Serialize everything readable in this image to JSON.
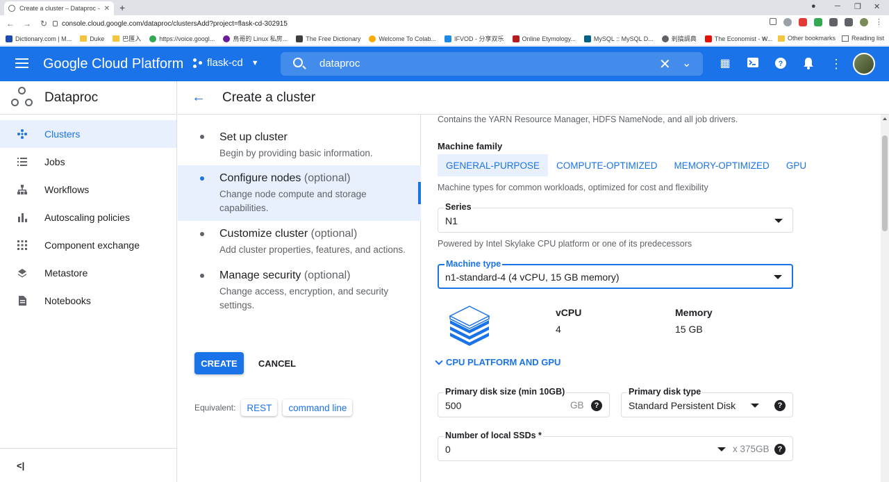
{
  "browser": {
    "tab_title": "Create a cluster – Dataproc – flas",
    "tab_close": "✕",
    "new_tab": "+",
    "url": "console.cloud.google.com/dataproc/clustersAdd?project=flask-cd-302915",
    "bookmarks": [
      "Dictionary.com | M...",
      "Duke",
      "巴匯入",
      "https://voice.googl...",
      "鳥哥的 Linux 私房...",
      "The Free Dictionary",
      "Welcome To Colab...",
      "IFVOD - 分享双乐",
      "Online Etymology...",
      "MySQL :: MySQL D...",
      "剎搞調典",
      "The Economist - W..."
    ],
    "more_bookmarks": "»",
    "other_bookmarks": "Other bookmarks",
    "reading_list": "Reading list"
  },
  "header": {
    "brand": "Google Cloud Platform",
    "project": "flask-cd",
    "search_value": "dataproc"
  },
  "nav": {
    "product": "Dataproc",
    "items": [
      {
        "label": "Clusters",
        "icon": "clusters-icon"
      },
      {
        "label": "Jobs",
        "icon": "list-icon"
      },
      {
        "label": "Workflows",
        "icon": "workflow-icon"
      },
      {
        "label": "Autoscaling policies",
        "icon": "bar-chart-icon"
      },
      {
        "label": "Component exchange",
        "icon": "grid-icon"
      },
      {
        "label": "Metastore",
        "icon": "metastore-icon"
      },
      {
        "label": "Notebooks",
        "icon": "document-icon"
      }
    ],
    "collapse": "<|"
  },
  "page": {
    "title": "Create a cluster"
  },
  "steps": [
    {
      "title": "Set up cluster",
      "optional": "",
      "desc": "Begin by providing basic information."
    },
    {
      "title": "Configure nodes",
      "optional": "(optional)",
      "desc": "Change node compute and storage capabilities."
    },
    {
      "title": "Customize cluster",
      "optional": "(optional)",
      "desc": "Add cluster properties, features, and actions."
    },
    {
      "title": "Manage security",
      "optional": "(optional)",
      "desc": "Change access, encryption, and security settings."
    }
  ],
  "actions": {
    "create": "CREATE",
    "cancel": "CANCEL",
    "equivalent": "Equivalent:",
    "rest": "REST",
    "command_line": "command line"
  },
  "form": {
    "master_desc": "Contains the YARN Resource Manager, HDFS NameNode, and all job drivers.",
    "machine_family_label": "Machine family",
    "machine_family_tabs": [
      "GENERAL-PURPOSE",
      "COMPUTE-OPTIMIZED",
      "MEMORY-OPTIMIZED",
      "GPU"
    ],
    "machine_family_desc": "Machine types for common workloads, optimized for cost and flexibility",
    "series_label": "Series",
    "series_value": "N1",
    "series_desc": "Powered by Intel Skylake CPU platform or one of its predecessors",
    "machine_type_label": "Machine type",
    "machine_type_value": "n1-standard-4 (4 vCPU, 15 GB memory)",
    "vcpu_label": "vCPU",
    "vcpu_value": "4",
    "memory_label": "Memory",
    "memory_value": "15 GB",
    "cpu_platform_toggle": "CPU PLATFORM AND GPU",
    "disk_size_label": "Primary disk size (min 10GB)",
    "disk_size_value": "500",
    "disk_size_unit": "GB",
    "disk_type_label": "Primary disk type",
    "disk_type_value": "Standard Persistent Disk",
    "ssd_label": "Number of local SSDs *",
    "ssd_value": "0",
    "ssd_unit": "x 375GB",
    "help_glyph": "?"
  },
  "colors": {
    "accent": "#1a73e8",
    "selected_bg": "#e8f0fe"
  }
}
